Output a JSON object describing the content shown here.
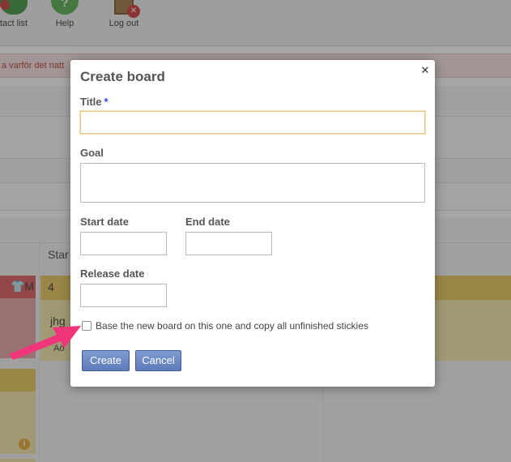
{
  "toolbar": {
    "contact_label": "tact list",
    "help_label": "Help",
    "help_glyph": "?",
    "logout_label": "Log out"
  },
  "alert_text": "a varför det natt",
  "board": {
    "column_header": "Star",
    "sticky_red_badge": "👕M",
    "sticky_yellow_count": "4",
    "sticky_yellow_text": "jhg",
    "sticky_yellow_small": "Aö",
    "info_glyph": "i"
  },
  "dialog": {
    "title": "Create board",
    "close_glyph": "✕",
    "title_label": "Title",
    "required_mark": "*",
    "goal_label": "Goal",
    "start_date_label": "Start date",
    "end_date_label": "End date",
    "release_date_label": "Release date",
    "copy_checkbox_label": "Base the new board on this one and copy all unfinished stickies",
    "create_button": "Create",
    "cancel_button": "Cancel",
    "fields": {
      "title_value": "",
      "goal_value": "",
      "start_date_value": "",
      "end_date_value": "",
      "release_date_value": ""
    },
    "copy_checked": false
  },
  "colors": {
    "accent": "#5d7bb9",
    "arrow": "#f0357a",
    "alert_text": "#b32525"
  },
  "icons": [
    "contact-list-icon",
    "help-icon",
    "logout-icon",
    "close-icon",
    "info-icon",
    "arrow-annotation"
  ]
}
